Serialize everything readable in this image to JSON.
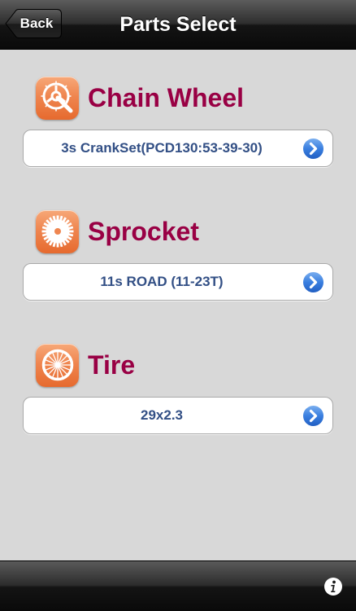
{
  "navbar": {
    "back_label": "Back",
    "title": "Parts Select"
  },
  "sections": [
    {
      "label": "Chain Wheel",
      "icon": "chainwheel-icon",
      "value": "3s CrankSet(PCD130:53-39-30)"
    },
    {
      "label": "Sprocket",
      "icon": "sprocket-icon",
      "value": "11s ROAD (11-23T)"
    },
    {
      "label": "Tire",
      "icon": "tire-icon",
      "value": "29x2.3"
    }
  ],
  "toolbar": {
    "info_icon": "info-icon"
  },
  "colors": {
    "section_label": "#990044",
    "selector_value": "#324f85",
    "icon_orange": "#ef8650",
    "disclosure_blue": "#2f6fd6",
    "background": "#d8d8d8"
  }
}
